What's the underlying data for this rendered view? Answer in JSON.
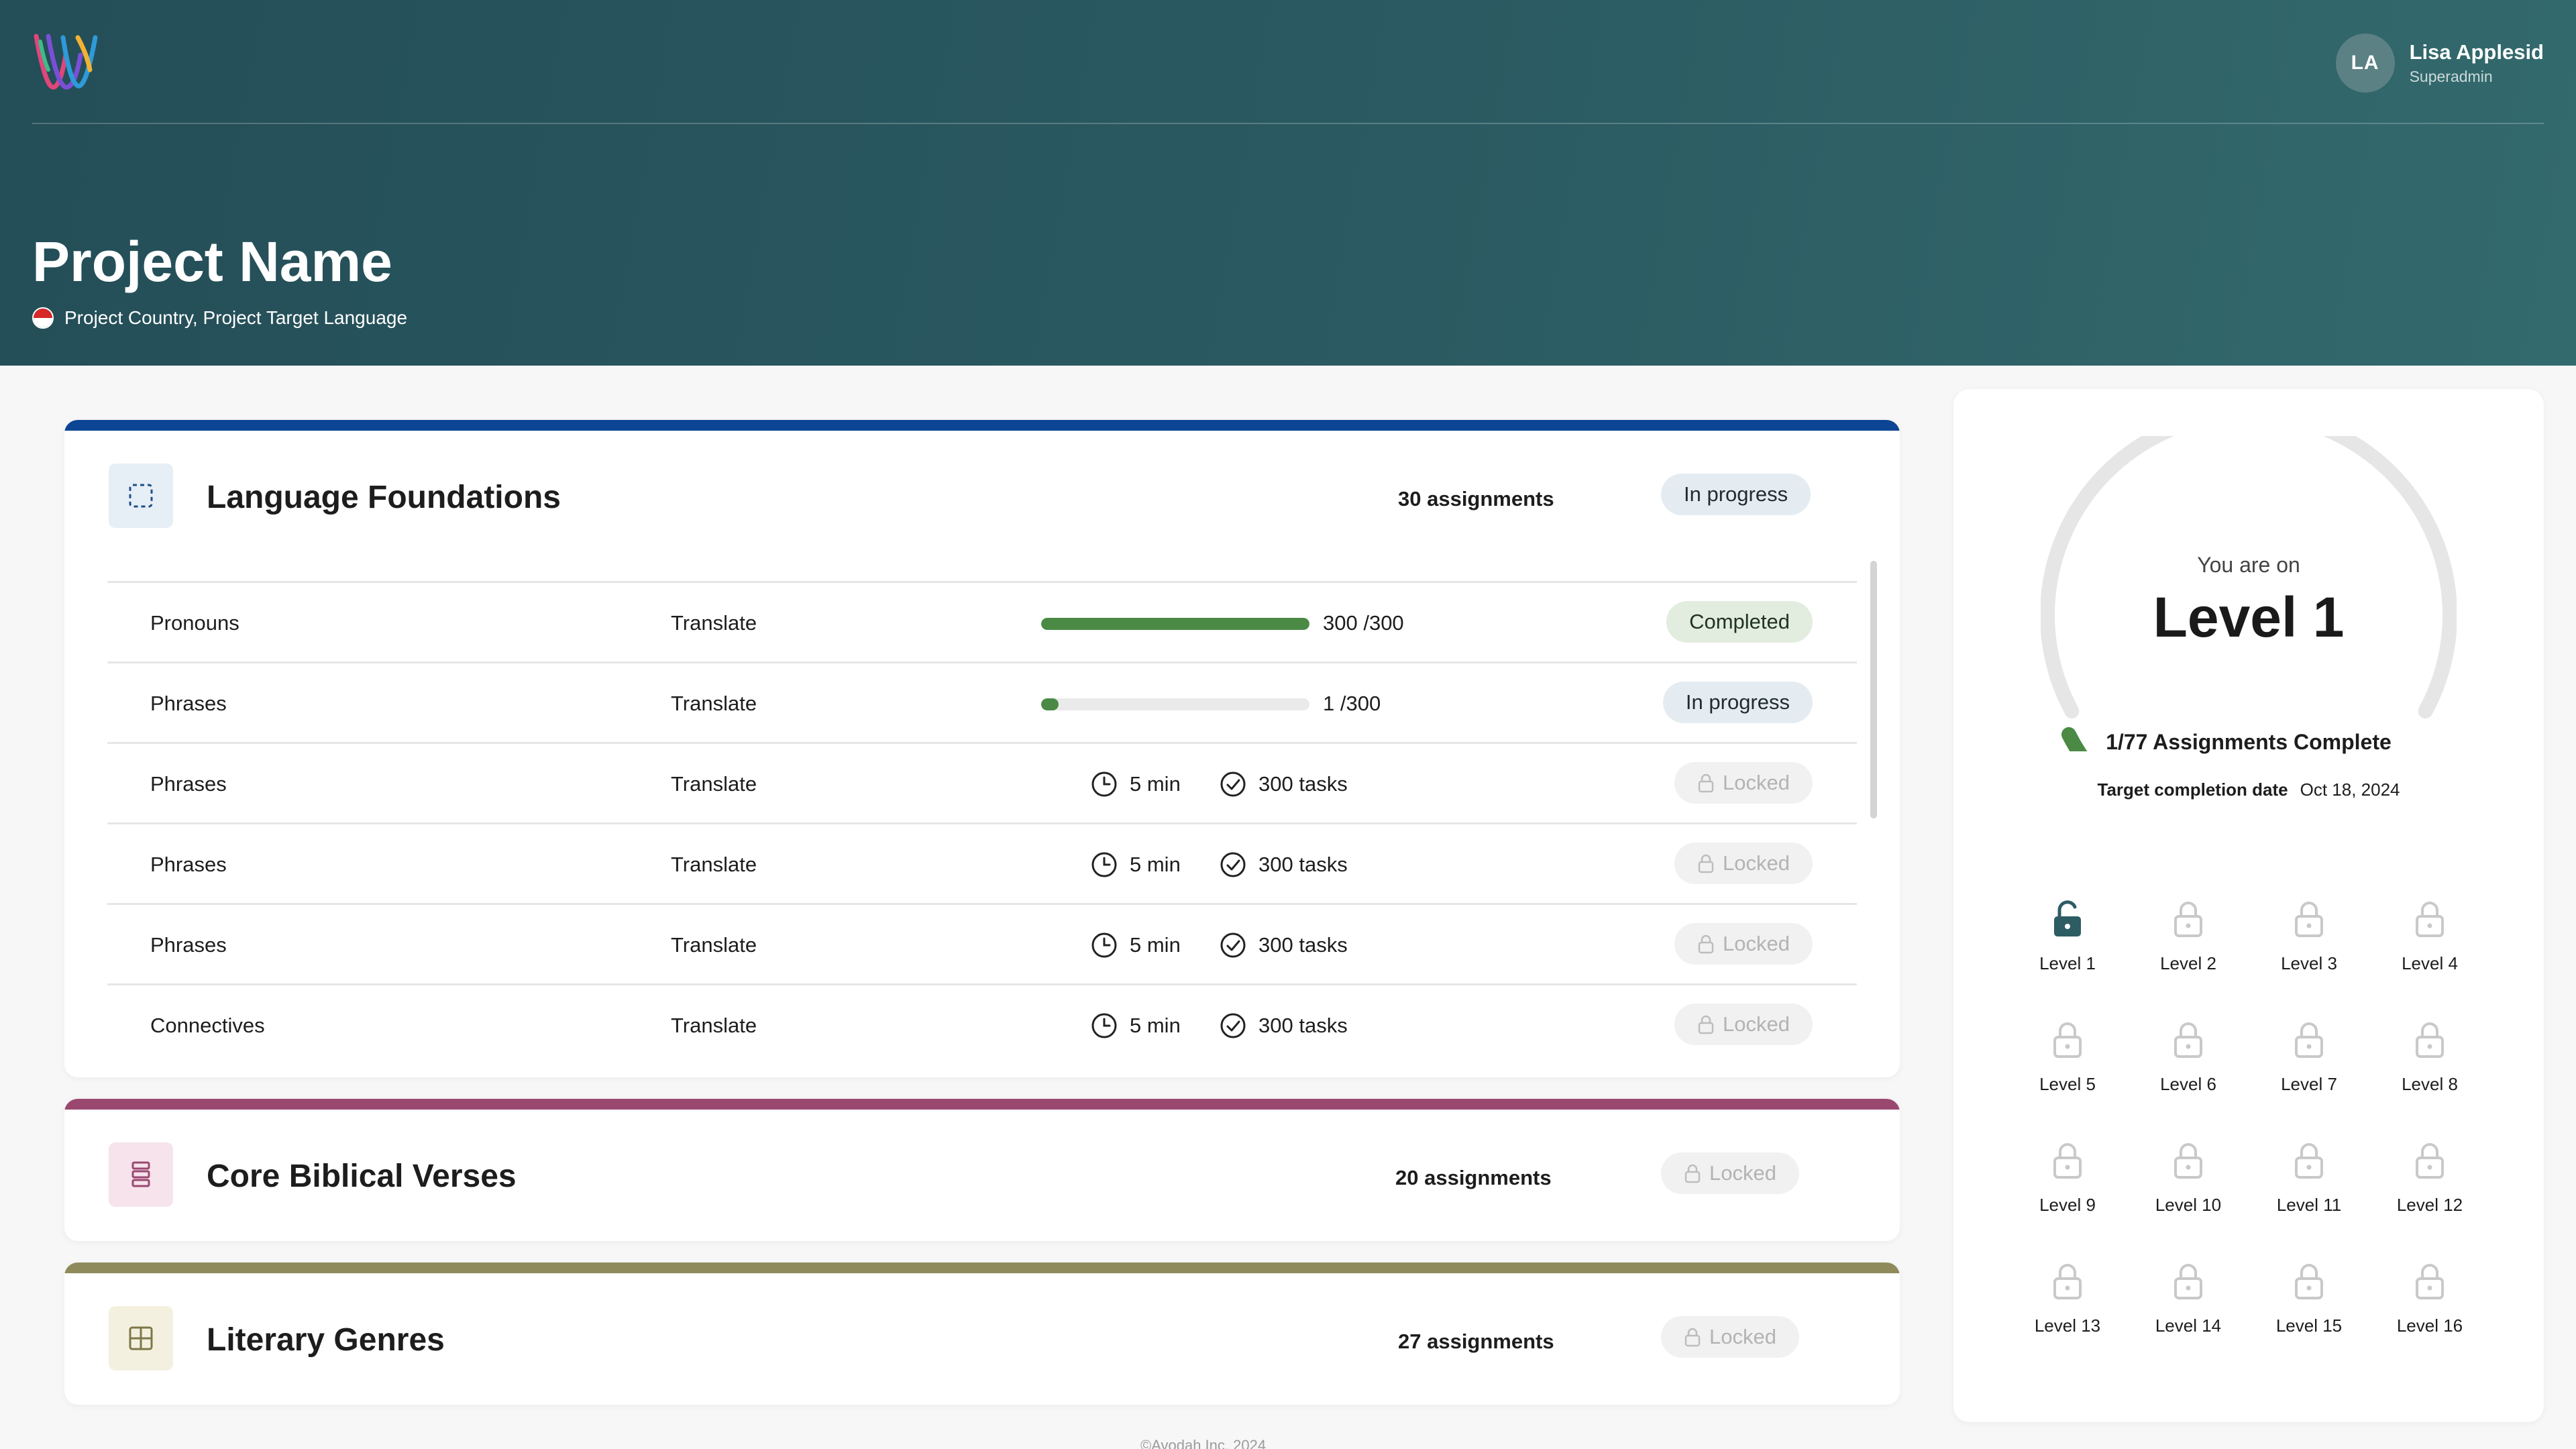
{
  "header": {
    "project_title": "Project Name",
    "project_subtitle": "Project Country, Project Target Language",
    "user": {
      "initials": "LA",
      "name": "Lisa Applesid",
      "role": "Superadmin"
    }
  },
  "colors": {
    "header_bg": "#2b5a62",
    "language_foundations_accent": "#0b4594",
    "core_biblical_accent": "#9b4870",
    "literary_genres_accent": "#8f8a5c",
    "progress_green": "#4a8a45"
  },
  "sections": [
    {
      "title": "Language Foundations",
      "assignments": "30 assignments",
      "status": "In progress",
      "icon": "dashed-square-icon",
      "rows": [
        {
          "name": "Pronouns",
          "type": "Translate",
          "progress_text": "300 /300",
          "progress": 1.0,
          "status": "Completed"
        },
        {
          "name": "Phrases",
          "type": "Translate",
          "progress_text": "1 /300",
          "progress": 0.0033,
          "status": "In progress"
        },
        {
          "name": "Phrases",
          "type": "Translate",
          "duration": "5 min",
          "tasks": "300 tasks",
          "status": "Locked"
        },
        {
          "name": "Phrases",
          "type": "Translate",
          "duration": "5 min",
          "tasks": "300 tasks",
          "status": "Locked"
        },
        {
          "name": "Phrases",
          "type": "Translate",
          "duration": "5 min",
          "tasks": "300 tasks",
          "status": "Locked"
        },
        {
          "name": "Connectives",
          "type": "Translate",
          "duration": "5 min",
          "tasks": "300 tasks",
          "status": "Locked"
        }
      ]
    },
    {
      "title": "Core Biblical Verses",
      "assignments": "20 assignments",
      "status": "Locked",
      "icon": "stacked-bars-icon"
    },
    {
      "title": "Literary Genres",
      "assignments": "27 assignments",
      "status": "Locked",
      "icon": "grid-icon"
    }
  ],
  "progress_panel": {
    "you_are_on": "You are on",
    "current_level": "Level 1",
    "assignments_complete": "1/77 Assignments Complete",
    "assignments_done": 1,
    "assignments_total": 77,
    "target_label": "Target completion date",
    "target_date": "Oct 18, 2024",
    "levels": [
      {
        "label": "Level 1",
        "unlocked": true
      },
      {
        "label": "Level 2",
        "unlocked": false
      },
      {
        "label": "Level 3",
        "unlocked": false
      },
      {
        "label": "Level 4",
        "unlocked": false
      },
      {
        "label": "Level 5",
        "unlocked": false
      },
      {
        "label": "Level 6",
        "unlocked": false
      },
      {
        "label": "Level 7",
        "unlocked": false
      },
      {
        "label": "Level 8",
        "unlocked": false
      },
      {
        "label": "Level 9",
        "unlocked": false
      },
      {
        "label": "Level 10",
        "unlocked": false
      },
      {
        "label": "Level 11",
        "unlocked": false
      },
      {
        "label": "Level 12",
        "unlocked": false
      },
      {
        "label": "Level 13",
        "unlocked": false
      },
      {
        "label": "Level 14",
        "unlocked": false
      },
      {
        "label": "Level 15",
        "unlocked": false
      },
      {
        "label": "Level 16",
        "unlocked": false
      }
    ]
  },
  "footer": {
    "text": "©Avodah Inc. 2024"
  }
}
